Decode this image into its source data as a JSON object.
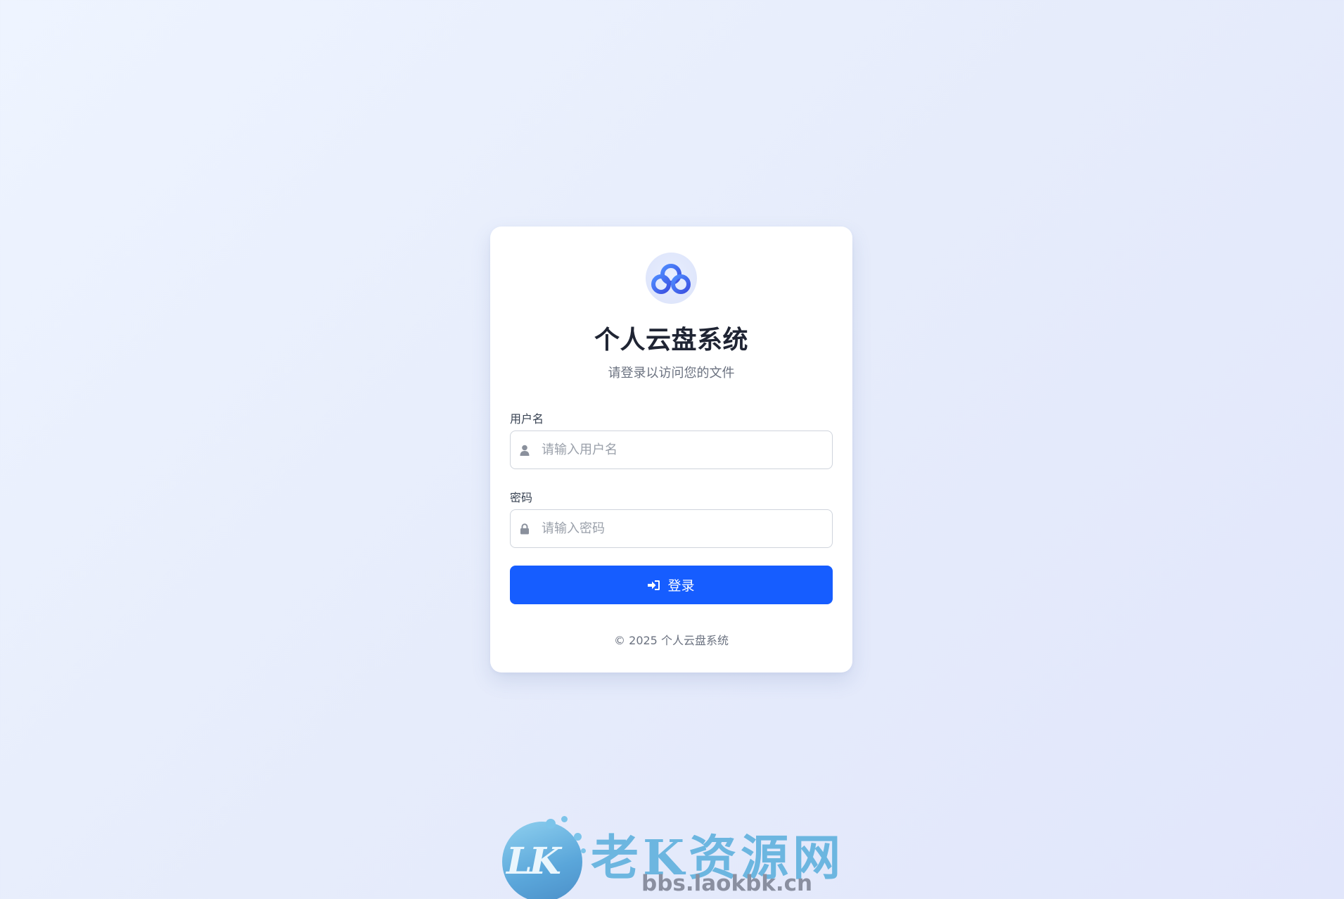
{
  "app": {
    "title": "个人云盘系统",
    "subtitle": "请登录以访问您的文件",
    "logo_icon": "cloud-icon",
    "accent_color": "#165dff"
  },
  "form": {
    "username": {
      "label": "用户名",
      "placeholder": "请输入用户名",
      "value": "",
      "icon": "user-icon"
    },
    "password": {
      "label": "密码",
      "placeholder": "请输入密码",
      "value": "",
      "icon": "lock-icon"
    },
    "submit": {
      "label": "登录",
      "icon": "sign-in-icon"
    }
  },
  "footer": {
    "copyright": "© 2025 个人云盘系统"
  },
  "watermark": {
    "logo_letters": "LK",
    "name": "老K资源网",
    "url": "bbs.laokbk.cn"
  }
}
